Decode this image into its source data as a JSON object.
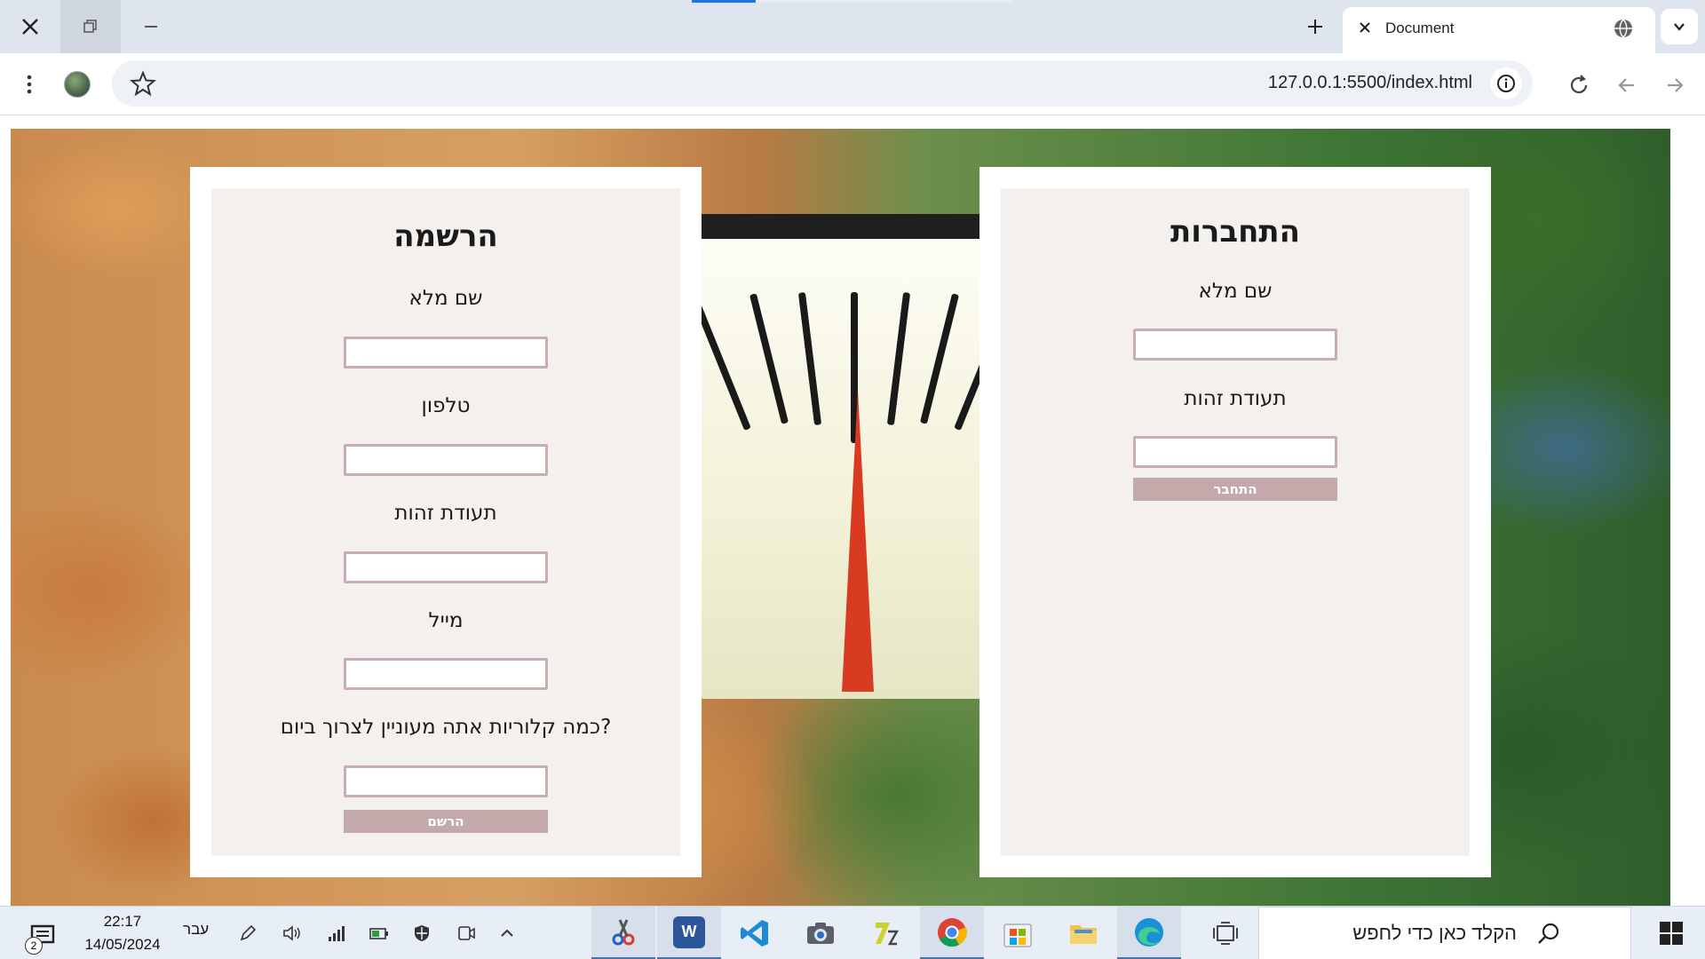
{
  "browser": {
    "tab_title": "Document",
    "url": "127.0.0.1:5500/index.html"
  },
  "register": {
    "heading": "הרשמה",
    "full_name_label": "שם מלא",
    "phone_label": "טלפון",
    "id_label": "תעודת זהות",
    "email_label": "מייל",
    "calories_label": "?כמה קלוריות אתה מעוניין לצרוך ביום",
    "submit_label": "הרשם"
  },
  "login": {
    "heading": "התחברות",
    "full_name_label": "שם מלא",
    "id_label": "תעודת זהות",
    "submit_label": "התחבר"
  },
  "taskbar": {
    "notification_count": "2",
    "time": "22:17",
    "date": "14/05/2024",
    "language": "עבר",
    "search_placeholder": "הקלד כאן כדי לחפש",
    "apps": [
      "snipping-tool",
      "word",
      "vscode",
      "camera",
      "7zip",
      "chrome",
      "store",
      "file-explorer",
      "edge",
      "task-view"
    ]
  },
  "colors": {
    "accent": "#1a73e8",
    "field_border": "#c8aeb0",
    "button_bg": "#c4a9ab",
    "needle": "#d93a22"
  }
}
